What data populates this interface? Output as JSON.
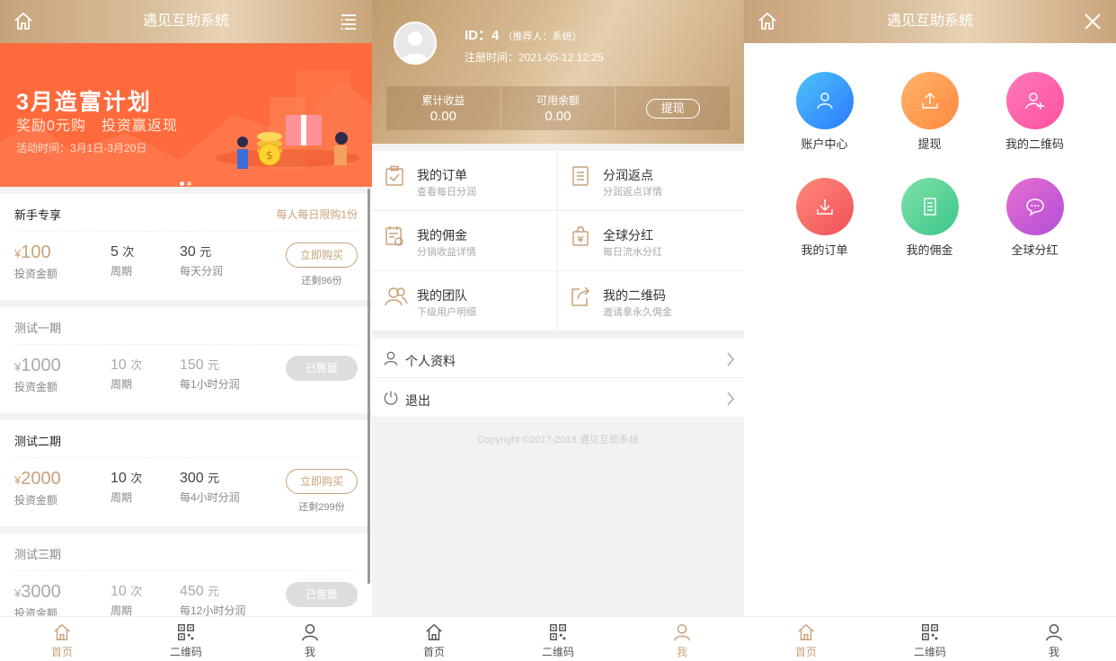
{
  "app_title": "遇见互助系统",
  "home": {
    "banner": {
      "title": "3月造富计划",
      "subtitle": "奖励0元购　投资赢返现",
      "date": "活动时间：3月1日-3月20日"
    },
    "products": [
      {
        "name": "新手专享",
        "limit": "每人每日限购1份",
        "amount": "100",
        "amount_label": "投资金额",
        "period": "5",
        "period_unit": "次",
        "period_label": "周期",
        "profit": "30",
        "profit_unit": "元",
        "profit_label": "每天分润",
        "button": "立即购买",
        "remain": "还剩96份",
        "sold": false
      },
      {
        "name": "测试一期",
        "amount": "1000",
        "amount_label": "投资金额",
        "period": "10",
        "period_unit": "次",
        "period_label": "周期",
        "profit": "150",
        "profit_unit": "元",
        "profit_label": "每1小时分润",
        "button": "已售罄",
        "sold": true
      },
      {
        "name": "测试二期",
        "amount": "2000",
        "amount_label": "投资金额",
        "period": "10",
        "period_unit": "次",
        "period_label": "周期",
        "profit": "300",
        "profit_unit": "元",
        "profit_label": "每4小时分润",
        "button": "立即购买",
        "remain": "还剩299份",
        "sold": false
      },
      {
        "name": "测试三期",
        "amount": "3000",
        "amount_label": "投资金额",
        "period": "10",
        "period_unit": "次",
        "period_label": "周期",
        "profit": "450",
        "profit_unit": "元",
        "profit_label": "每12小时分润",
        "button": "已售罄",
        "sold": true
      }
    ],
    "currency": "¥"
  },
  "tabs": {
    "home": "首页",
    "qrcode": "二维码",
    "me": "我"
  },
  "profile": {
    "id_label": "ID：",
    "id": "4",
    "referrer": "（推荐人：系统）",
    "reg_time": "注册时间：2021-05-12 12:25",
    "stats": [
      {
        "label": "累计收益",
        "value": "0.00"
      },
      {
        "label": "可用余额",
        "value": "0.00"
      }
    ],
    "withdraw": "提现",
    "grid": [
      {
        "title": "我的订单",
        "sub": "查看每日分润",
        "icon": "clipboard-check-icon"
      },
      {
        "title": "分润返点",
        "sub": "分润返点详情",
        "icon": "document-list-icon"
      },
      {
        "title": "我的佣金",
        "sub": "分销收益详情",
        "icon": "calendar-money-icon"
      },
      {
        "title": "全球分红",
        "sub": "每日流水分红",
        "icon": "money-bag-icon"
      },
      {
        "title": "我的团队",
        "sub": "下级用户明细",
        "icon": "team-icon"
      },
      {
        "title": "我的二维码",
        "sub": "邀请拿永久佣金",
        "icon": "share-icon"
      }
    ],
    "rows": [
      {
        "label": "个人资料",
        "icon": "user-icon"
      },
      {
        "label": "退出",
        "icon": "power-icon"
      }
    ],
    "copyright": "Copyright ©2017-2018 遇见互助系统"
  },
  "menu": {
    "items": [
      {
        "label": "账户中心",
        "color_from": "#4fc3f7",
        "color_to": "#2979ff",
        "icon": "user-icon"
      },
      {
        "label": "提现",
        "color_from": "#ffb36b",
        "color_to": "#ff8a3d",
        "icon": "upload-icon"
      },
      {
        "label": "我的二维码",
        "color_from": "#ff7ab8",
        "color_to": "#ff4fa0",
        "icon": "add-user-icon"
      },
      {
        "label": "我的订单",
        "color_from": "#ff8a7a",
        "color_to": "#f0505a",
        "icon": "download-icon"
      },
      {
        "label": "我的佣金",
        "color_from": "#7ee0a8",
        "color_to": "#3cc78a",
        "icon": "document-icon"
      },
      {
        "label": "全球分红",
        "color_from": "#e96fd0",
        "color_to": "#b04ed8",
        "icon": "chat-icon"
      }
    ]
  }
}
